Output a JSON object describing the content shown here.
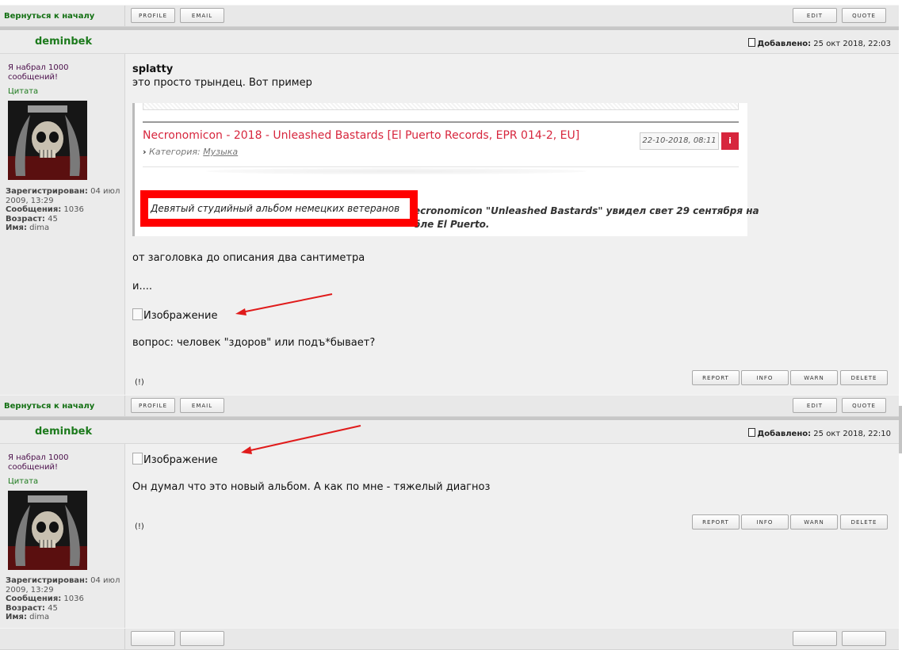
{
  "top_bar": {
    "back_link": "Вернуться к началу",
    "profile": "PROFILE",
    "email": "EMAIL",
    "edit": "EDIT",
    "quote": "QUOTE"
  },
  "posts": [
    {
      "author": "deminbek",
      "added_label": "Добавлено:",
      "added_time": "25 окт 2018, 22:03",
      "rank": "Я набрал 1000 сообщений!",
      "quote_label": "Цитата",
      "registered_label": "Зарегистрирован:",
      "registered_value": "04 июл 2009, 13:29",
      "messages_label": "Сообщения:",
      "messages_value": "1036",
      "age_label": "Возраст:",
      "age_value": "45",
      "name_label": "Имя:",
      "name_value": "dima",
      "quoted_user": "splatty",
      "line1": "это просто трындец. Вот пример",
      "embed": {
        "title": "Necronomicon - 2018 - Unleashed Bastards [El Puerto Records, EPR 014-2, EU]",
        "category_label": "Категория:",
        "category_value": "Музыка",
        "date": "22-10-2018, 08:11",
        "info_icon": "i",
        "highlight": "Девятый студийный альбом немецких ветеранов",
        "desc_line1": "ecronomicon \"Unleashed Bastards\" увидел свет 29 сентября на",
        "desc_line2": "бле El Puerto."
      },
      "line2": "от заголовка до описания два сантиметра",
      "line3": "и....",
      "image_alt": "Изображение",
      "line4": "вопрос: человек \"здоров\" или подъ*бывает?",
      "flag": "(!)",
      "actions": [
        "REPORT",
        "INFO",
        "WARN",
        "DELETE"
      ]
    },
    {
      "author": "deminbek",
      "added_label": "Добавлено:",
      "added_time": "25 окт 2018, 22:10",
      "rank": "Я набрал 1000 сообщений!",
      "quote_label": "Цитата",
      "registered_label": "Зарегистрирован:",
      "registered_value": "04 июл 2009, 13:29",
      "messages_label": "Сообщения:",
      "messages_value": "1036",
      "age_label": "Возраст:",
      "age_value": "45",
      "name_label": "Имя:",
      "name_value": "dima",
      "image_alt": "Изображение",
      "line1": "Он думал что это новый альбом. А как по мне - тяжелый диагноз",
      "flag": "(!)",
      "actions": [
        "REPORT",
        "INFO",
        "WARN",
        "DELETE"
      ]
    }
  ],
  "colors": {
    "author_green": "#1c7a1c",
    "embed_title": "#d7263d",
    "highlight_box": "#ff0000",
    "arrow": "#e01b1b"
  },
  "icons": [
    "document-icon",
    "broken-image-icon",
    "red-arrow-icon",
    "info-icon",
    "chevron-right-icon"
  ]
}
